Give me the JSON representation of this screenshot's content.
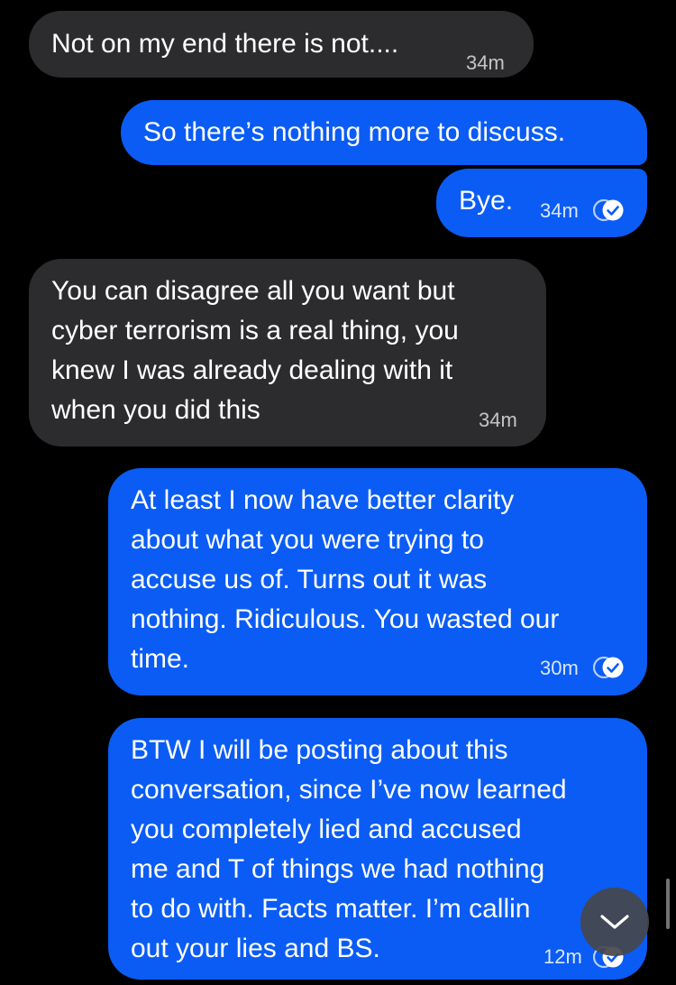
{
  "messages": [
    {
      "direction": "incoming",
      "text": "Not on my end there is not....",
      "time": "34m"
    },
    {
      "direction": "outgoing",
      "text": "So there’s nothing more to discuss.",
      "time": ""
    },
    {
      "direction": "outgoing",
      "text": "Bye.",
      "time": "34m",
      "status": "seen-check-icon"
    },
    {
      "direction": "incoming",
      "text": "You can disagree all you want but\ncyber terrorism is a real thing, you\nknew I was already dealing with it\nwhen you did this",
      "time": "34m"
    },
    {
      "direction": "outgoing",
      "text": "At least I now have better clarity\nabout what you were trying to\naccuse us of. Turns out it was\nnothing. Ridiculous. You wasted our\ntime.",
      "time": "30m",
      "status": "seen-check-icon"
    },
    {
      "direction": "outgoing",
      "text": "BTW I will be posting about this\nconversation, since I’ve now learned\nyou completely lied and accused\nme and T of things we had nothing\nto do with. Facts matter. I’m callin\nout your lies and BS.",
      "time": "12m",
      "status": "seen-check-icon"
    }
  ],
  "scroll_button": {
    "icon": "chevron-down-icon"
  },
  "colors": {
    "background": "#000000",
    "incoming_bubble": "#2c2c2e",
    "outgoing_bubble": "#0a5cf5",
    "text": "#ffffff"
  }
}
